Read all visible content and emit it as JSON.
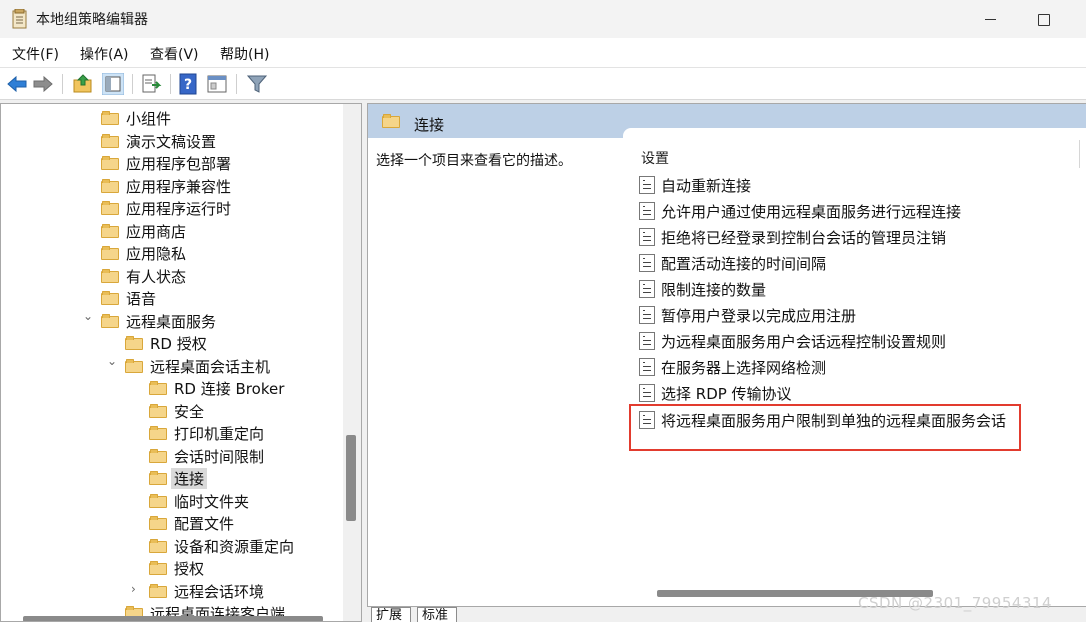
{
  "window": {
    "title": "本地组策略编辑器"
  },
  "menu": [
    {
      "label": "文件(F)"
    },
    {
      "label": "操作(A)"
    },
    {
      "label": "查看(V)"
    },
    {
      "label": "帮助(H)"
    }
  ],
  "toolbar": {
    "icons": [
      "back-arrow-icon",
      "forward-arrow-icon",
      "up-folder-icon",
      "show-hide-tree-icon",
      "export-list-icon",
      "help-icon",
      "properties-view-icon",
      "filter-icon"
    ]
  },
  "tree": {
    "items": [
      {
        "label": "小组件"
      },
      {
        "label": "演示文稿设置"
      },
      {
        "label": "应用程序包部署"
      },
      {
        "label": "应用程序兼容性"
      },
      {
        "label": "应用程序运行时"
      },
      {
        "label": "应用商店"
      },
      {
        "label": "应用隐私"
      },
      {
        "label": "有人状态"
      },
      {
        "label": "语音"
      },
      {
        "label": "远程桌面服务",
        "expander": "⌄"
      },
      {
        "label": "RD 授权"
      },
      {
        "label": "远程桌面会话主机",
        "expander": "⌄"
      },
      {
        "label": "RD 连接 Broker"
      },
      {
        "label": "安全"
      },
      {
        "label": "打印机重定向"
      },
      {
        "label": "会话时间限制"
      },
      {
        "label": "连接",
        "selected": true
      },
      {
        "label": "临时文件夹"
      },
      {
        "label": "配置文件"
      },
      {
        "label": "设备和资源重定向"
      },
      {
        "label": "授权"
      },
      {
        "label": "远程会话环境",
        "expander": "›"
      },
      {
        "label": "远程桌面连接客户端"
      }
    ]
  },
  "right": {
    "header_title": "连接",
    "description": "选择一个项目来查看它的描述。",
    "column_header": "设置",
    "policies": [
      {
        "label": "自动重新连接"
      },
      {
        "label": "允许用户通过使用远程桌面服务进行远程连接"
      },
      {
        "label": "拒绝将已经登录到控制台会话的管理员注销"
      },
      {
        "label": "配置活动连接的时间间隔"
      },
      {
        "label": "限制连接的数量"
      },
      {
        "label": "暂停用户登录以完成应用注册"
      },
      {
        "label": "为远程桌面服务用户会话远程控制设置规则"
      },
      {
        "label": "在服务器上选择网络检测"
      },
      {
        "label": "选择 RDP 传输协议"
      },
      {
        "label": "将远程桌面服务用户限制到单独的远程桌面服务会话",
        "highlighted": true
      }
    ]
  },
  "tabs": [
    {
      "label": "扩展"
    },
    {
      "label": "标准"
    }
  ],
  "watermark": "CSDN @2301_79954314",
  "colors": {
    "header_bg": "#bdd0e6",
    "highlight_border": "#e23b2e",
    "folder_fill": "#f5d58a"
  }
}
